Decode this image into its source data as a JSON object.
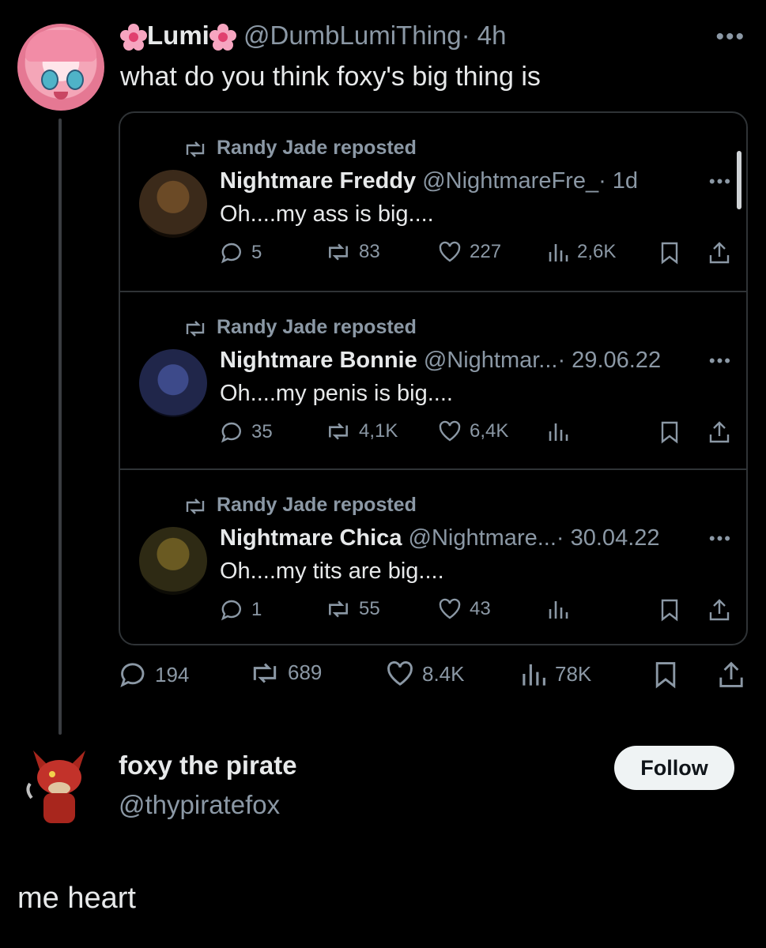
{
  "main_tweet": {
    "name": "Lumi",
    "handle": "@DumbLumiThing",
    "time": "· 4h",
    "more": "•••",
    "text": "what do you think foxy's big thing is",
    "stats": {
      "replies": "194",
      "reposts": "689",
      "likes": "8.4K",
      "views": "78K"
    }
  },
  "quoted_timeline": [
    {
      "reposted_by": "Randy Jade reposted",
      "name": "Nightmare Freddy",
      "handle": "@NightmareFre_",
      "time": "· 1d",
      "more": "•••",
      "text": "Oh....my ass is big....",
      "replies": "5",
      "reposts": "83",
      "likes": "227",
      "views": "2,6K",
      "avatar_color": "#3b2a1a"
    },
    {
      "reposted_by": "Randy Jade reposted",
      "name": "Nightmare Bonnie",
      "handle": "@Nightmar...",
      "time": "· 29.06.22",
      "more": "•••",
      "text": "Oh....my penis is big....",
      "replies": "35",
      "reposts": "4,1K",
      "likes": "6,4K",
      "views": "",
      "avatar_color": "#20264a"
    },
    {
      "reposted_by": "Randy Jade reposted",
      "name": "Nightmare Chica",
      "handle": "@Nightmare...",
      "time": "· 30.04.22",
      "more": "•••",
      "text": "Oh....my tits are big....",
      "replies": "1",
      "reposts": "55",
      "likes": "43",
      "views": "",
      "avatar_color": "#2e2a14"
    }
  ],
  "reply_user": {
    "name": "foxy the pirate",
    "handle": "@thypiratefox",
    "follow_label": "Follow"
  },
  "caption": "me heart",
  "colors": {
    "background": "#000000",
    "text": "#e7e9ea",
    "muted": "#8b98a5",
    "border": "#2f3336"
  }
}
